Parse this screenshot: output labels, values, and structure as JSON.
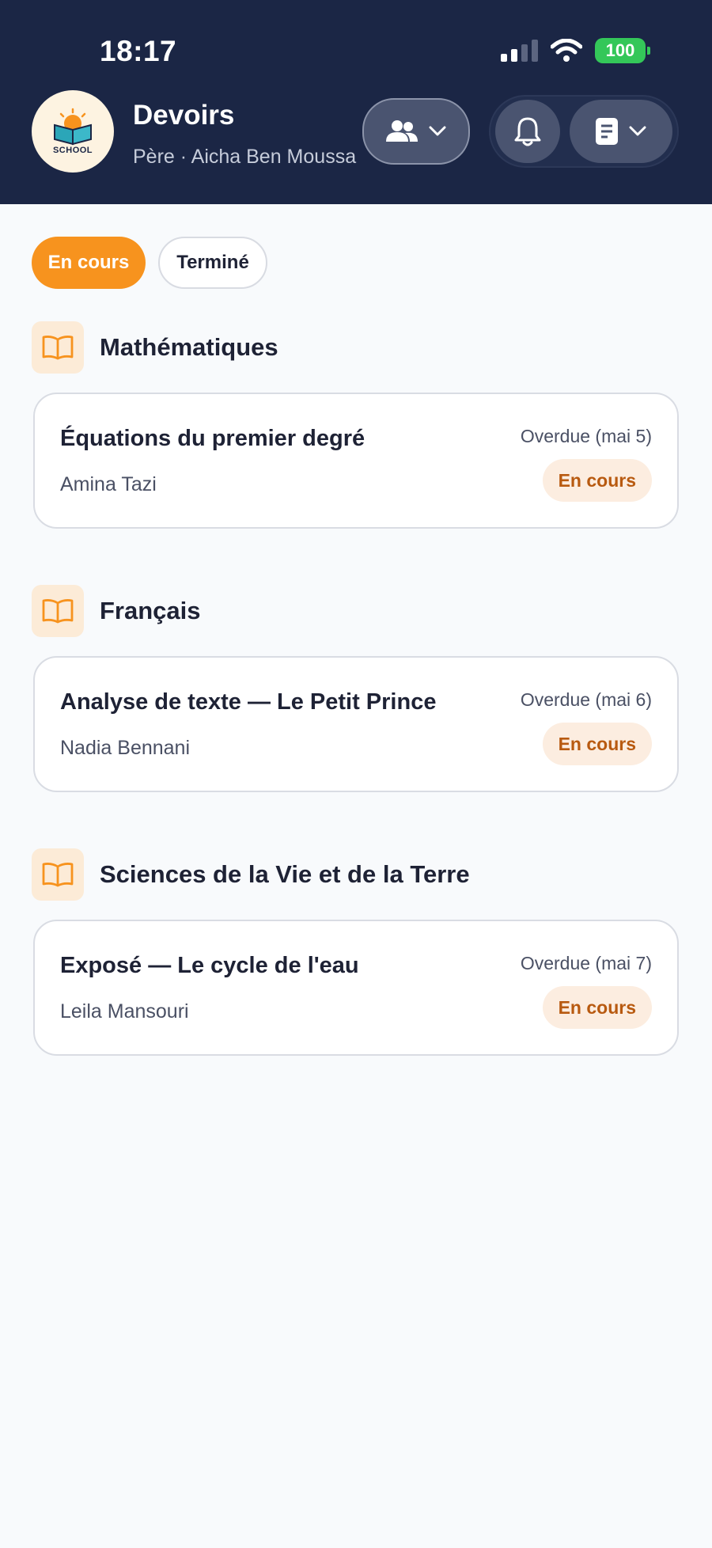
{
  "status_bar": {
    "time": "18:17",
    "battery": "100"
  },
  "header": {
    "logo_text": "SCHOOL",
    "title": "Devoirs",
    "subtitle": "Père · Aicha Ben Moussa"
  },
  "tabs": [
    {
      "label": "En cours",
      "active": true
    },
    {
      "label": "Terminé",
      "active": false
    }
  ],
  "sections": [
    {
      "subject": "Mathématiques",
      "assignment": {
        "title": "Équations du premier degré",
        "teacher": "Amina Tazi",
        "due": "Overdue (mai 5)",
        "status": "En cours"
      }
    },
    {
      "subject": "Français",
      "assignment": {
        "title": "Analyse de texte — Le Petit Prince",
        "teacher": "Nadia Bennani",
        "due": "Overdue (mai 6)",
        "status": "En cours"
      }
    },
    {
      "subject": "Sciences de la Vie et de la Terre",
      "assignment": {
        "title": "Exposé — Le cycle de l'eau",
        "teacher": "Leila Mansouri",
        "due": "Overdue (mai 7)",
        "status": "En cours"
      }
    }
  ],
  "colors": {
    "header_bg": "#1B2645",
    "accent": "#F7931E",
    "badge_bg": "#FCEDE0",
    "badge_text": "#B85A10",
    "battery": "#34C759"
  },
  "icons": [
    "signal-icon",
    "wifi-icon",
    "battery-icon",
    "school-logo-icon",
    "users-icon",
    "chevron-down-icon",
    "bell-icon",
    "document-icon",
    "book-icon"
  ]
}
